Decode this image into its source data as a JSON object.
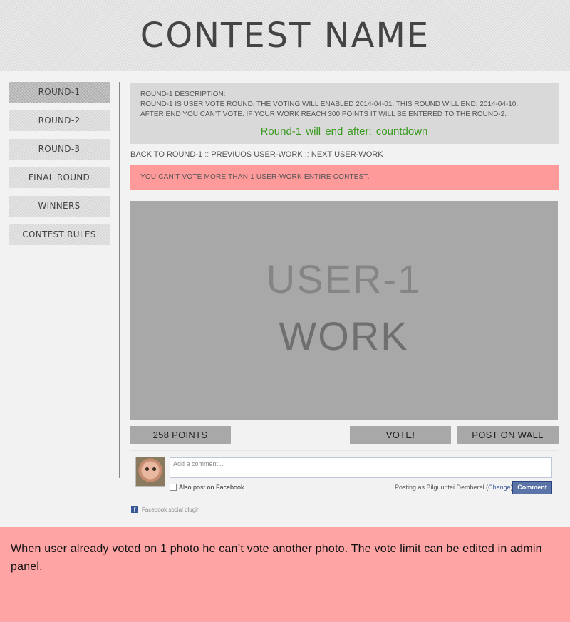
{
  "header": {
    "title": "CONTEST NAME"
  },
  "sidebar": {
    "items": [
      {
        "label": "ROUND-1"
      },
      {
        "label": "ROUND-2"
      },
      {
        "label": "ROUND-3"
      },
      {
        "label": "FINAL ROUND"
      },
      {
        "label": "WINNERS"
      },
      {
        "label": "CONTEST RULES"
      }
    ],
    "active_index": 0
  },
  "description": {
    "heading": "ROUND-1 DESCRIPTION:",
    "line1": "ROUND-1 IS USER VOTE ROUND. THE VOTING WILL ENABLED 2014-04-01.  THIS ROUND WILL END: 2014-04-10.",
    "line2": "AFTER END YOU CAN’T VOTE. IF YOUR WORK REACH 300 POINTS IT WILL BE ENTERED TO THE ROUND-2.",
    "countdown": "Round-1 will end after:  countdown"
  },
  "nav": {
    "back": "BACK TO ROUND-1",
    "sep": " :: ",
    "previous": "PREVIUOS USER-WORK",
    "next": "NEXT USER-WORK"
  },
  "alert": {
    "text": "YOU CAN’T VOTE MORE THAN 1 USER-WORK ENTIRE CONTEST."
  },
  "work": {
    "line1": "USER-1",
    "line2": "WORK"
  },
  "actions": {
    "points": "258 POINTS",
    "vote": "VOTE!",
    "post_on_wall": "POST ON WALL"
  },
  "facebook": {
    "placeholder": "Add a comment...",
    "also_post": "Also post on Facebook",
    "posting_as": "Posting as Bilguuntei Demberel (",
    "change": "Change",
    "posting_close": ")",
    "comment_button": "Comment",
    "plugin_label": "Facebook social plugin"
  },
  "note": {
    "text": "When user already voted on 1 photo he can’t vote another photo. The vote limit can be edited in admin panel."
  },
  "colors": {
    "alert_bg": "#ff9a9a",
    "note_bg": "#ffa4a4",
    "countdown": "#3a9a20",
    "fb_button": "#5b74a8"
  }
}
